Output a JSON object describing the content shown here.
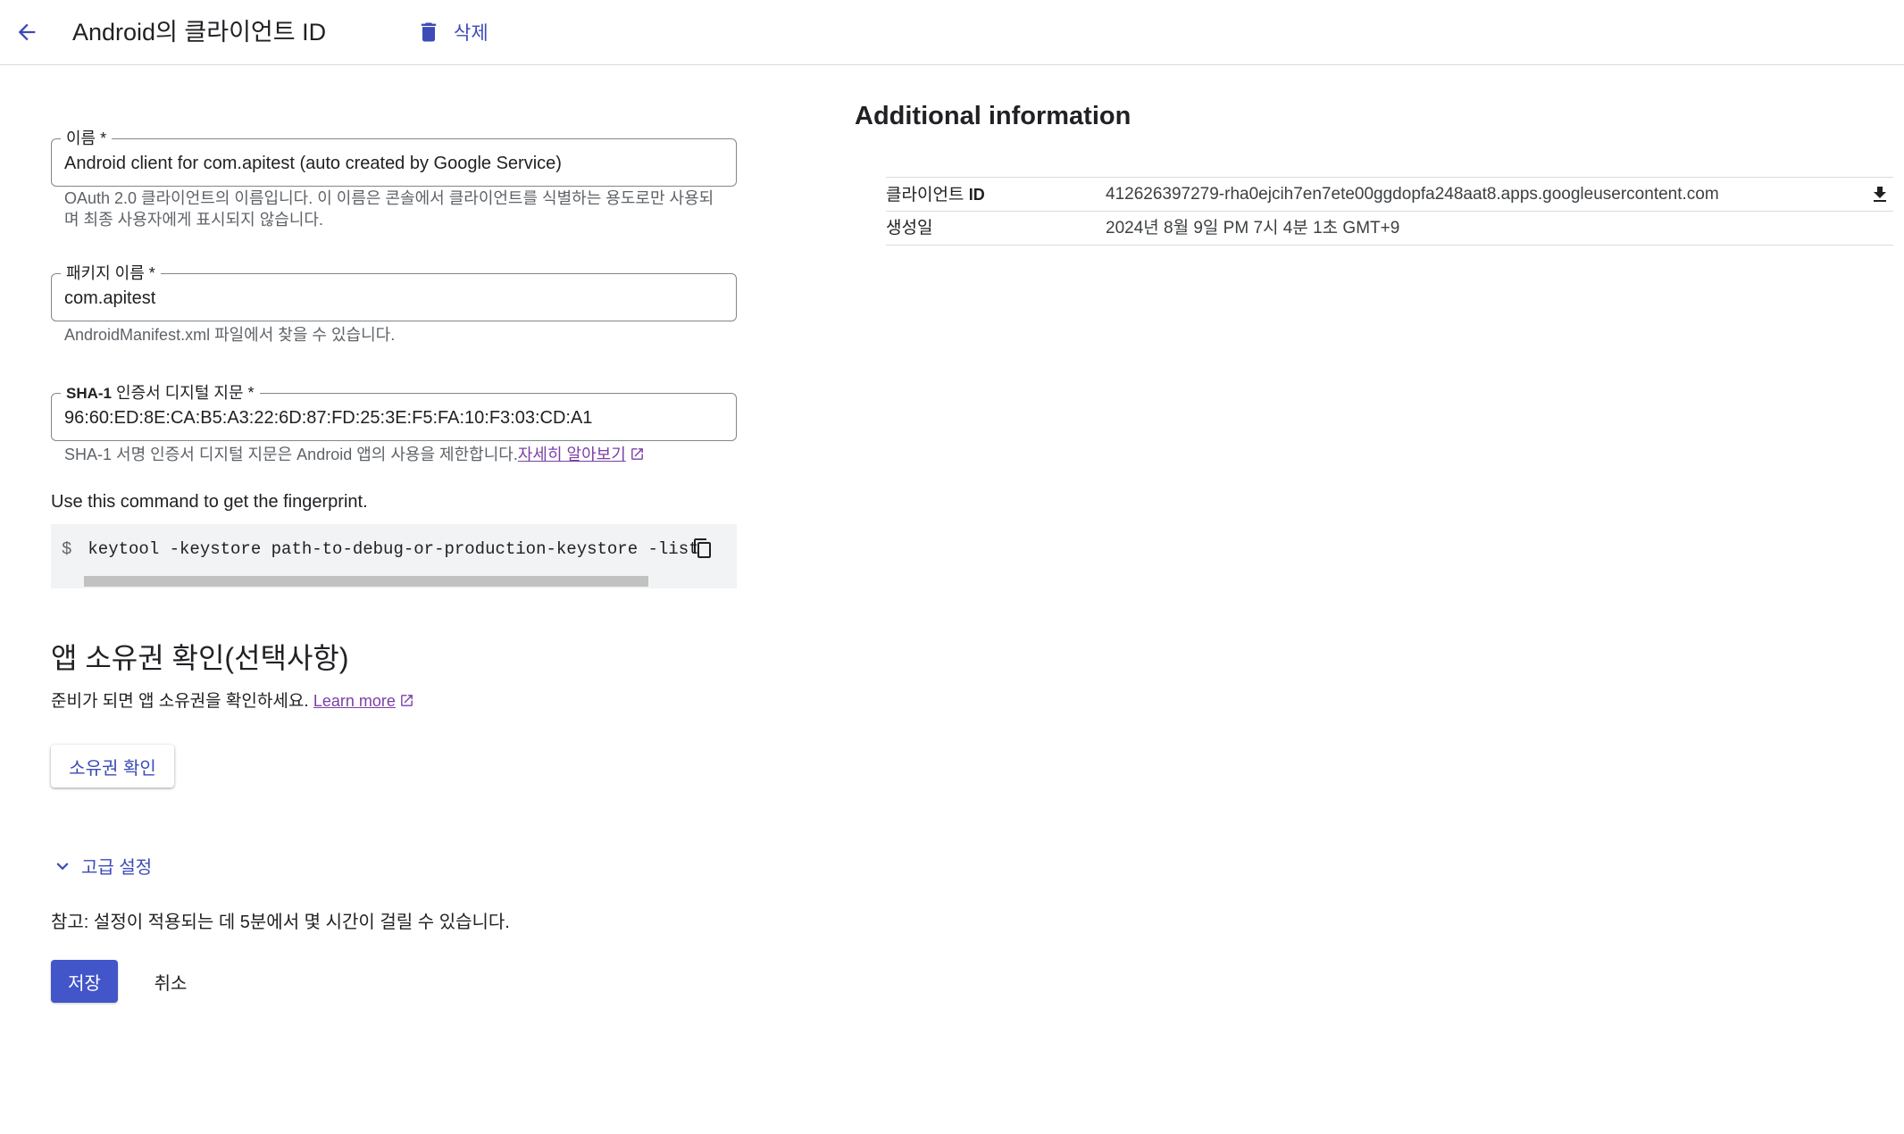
{
  "header": {
    "title": "Android의 클라이언트 ID",
    "delete_label": "삭제"
  },
  "form": {
    "name": {
      "label": "이름 *",
      "value": "Android client for com.apitest (auto created by Google Service)",
      "hint": "OAuth 2.0 클라이언트의 이름입니다. 이 이름은 콘솔에서 클라이언트를 식별하는 용도로만 사용되며 최종 사용자에게 표시되지 않습니다."
    },
    "package": {
      "label": "패키지 이름 *",
      "value": "com.apitest",
      "hint": "AndroidManifest.xml 파일에서 찾을 수 있습니다."
    },
    "sha1": {
      "label_bold": "SHA-1",
      "label_rest": " 인증서 디지털 지문 *",
      "value": "96:60:ED:8E:CA:B5:A3:22:6D:87:FD:25:3E:F5:FA:10:F3:03:CD:A1",
      "hint": "SHA-1 서명 인증서 디지털 지문은 Android 앱의 사용을 제한합니다.",
      "hint_link": "자세히 알아보기"
    },
    "command_label": "Use this command to get the fingerprint.",
    "command_prompt": "$",
    "command": "keytool -keystore path-to-debug-or-production-keystore -list"
  },
  "ownership": {
    "title": "앱 소유권 확인(선택사항)",
    "desc": "준비가 되면 앱 소유권을 확인하세요. ",
    "link": "Learn more",
    "button": "소유권 확인"
  },
  "advanced_label": "고급 설정",
  "note": "참고: 설정이 적용되는 데 5분에서 몇 시간이 걸릴 수 있습니다.",
  "actions": {
    "save": "저장",
    "cancel": "취소"
  },
  "info": {
    "title": "Additional information",
    "client_id_key": "클라이언트 ",
    "client_id_key_bold": "ID",
    "client_id_value": "412626397279-rha0ejcih7en7ete00ggdopfa248aat8.apps.googleusercontent.com",
    "created_key": "생성일",
    "created_value": "2024년 8월 9일 PM 7시 4분 1초 GMT+9"
  },
  "colors": {
    "accent": "#4255c9",
    "link": "#7b3fa5",
    "border": "#dadce0"
  }
}
